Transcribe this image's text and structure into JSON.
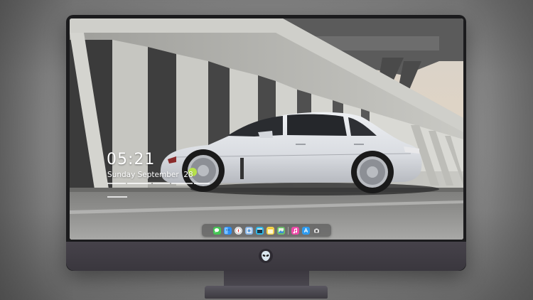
{
  "lockscreen": {
    "time": "05:21",
    "date": "Sunday September  28"
  },
  "dock": {
    "apps": [
      {
        "name": "messages-icon",
        "color": "#45c655"
      },
      {
        "name": "finder-icon",
        "color": "#2c8ef5"
      },
      {
        "name": "safari-icon",
        "color": "#e8e8e8"
      },
      {
        "name": "preview-icon",
        "color": "#8cb8e8"
      },
      {
        "name": "clapper-icon",
        "color": "#2fb8e8"
      },
      {
        "name": "notes-icon",
        "color": "#f5d44a"
      },
      {
        "name": "photos-icon",
        "color": "#6cc06a"
      },
      {
        "name": "music-icon",
        "color": "#ee4aa8"
      },
      {
        "name": "app-store-icon",
        "color": "#2e9cf0"
      },
      {
        "name": "camera-icon",
        "color": "#6b6b6b"
      }
    ]
  }
}
